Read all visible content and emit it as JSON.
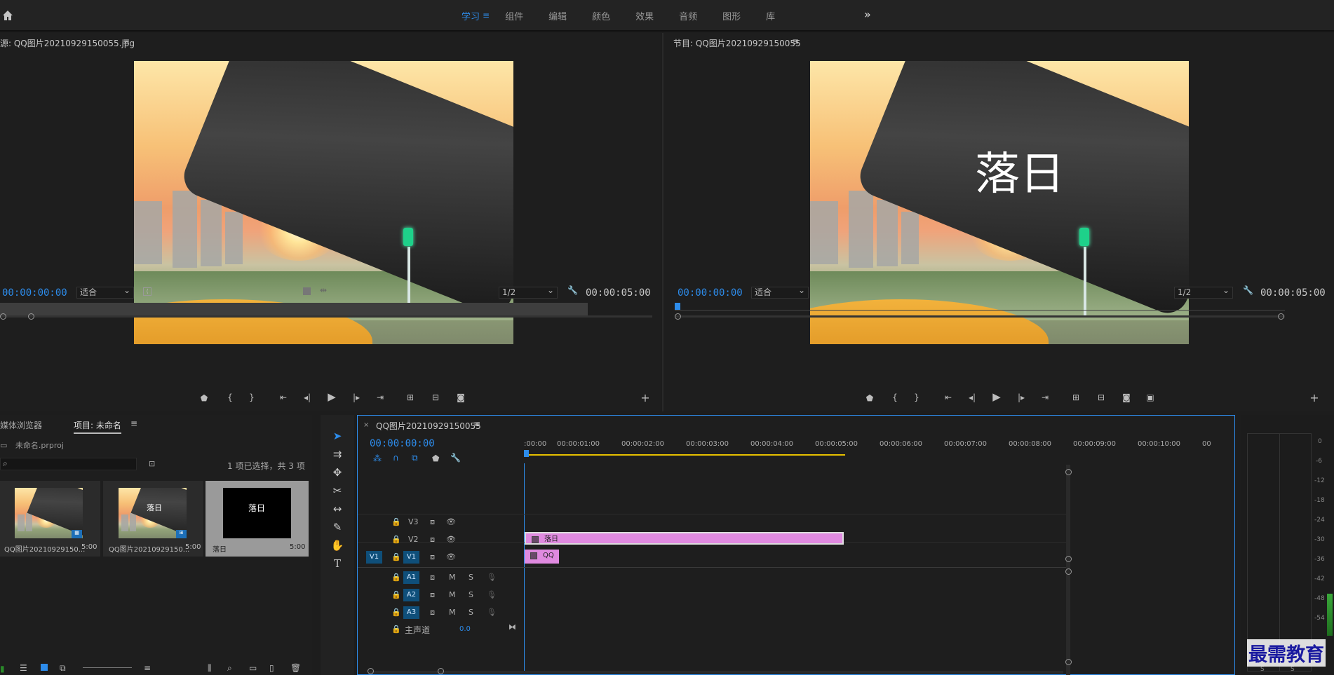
{
  "topbar": {
    "workspaces": [
      "学习",
      "组件",
      "编辑",
      "颜色",
      "效果",
      "音频",
      "图形",
      "库"
    ],
    "active": "学习"
  },
  "source": {
    "title": "源: QQ图片20210929150055.jpg",
    "timecode": "00:00:00:00",
    "fit": "适合",
    "res": "1/2",
    "duration": "00:00:05:00"
  },
  "program": {
    "title": "节目: QQ图片20210929150055",
    "timecode": "00:00:00:00",
    "fit": "适合",
    "res": "1/2",
    "duration": "00:00:05:00",
    "overlay_text": "落日"
  },
  "project": {
    "tab_media": "媒体浏览器",
    "tab_project": "项目: 未命名",
    "file": "未命名.prproj",
    "selection": "1 项已选择，共 3 项",
    "items": [
      {
        "name": "QQ图片20210929150...",
        "dur": "5:00"
      },
      {
        "name": "QQ图片20210929150...",
        "dur": "5:00"
      },
      {
        "name": "落日",
        "dur": "5:00",
        "text": "落日"
      }
    ]
  },
  "timeline": {
    "title": "QQ图片20210929150055",
    "timecode": "00:00:00:00",
    "ruler": [
      ":00:00",
      "00:00:01:00",
      "00:00:02:00",
      "00:00:03:00",
      "00:00:04:00",
      "00:00:05:00",
      "00:00:06:00",
      "00:00:07:00",
      "00:00:08:00",
      "00:00:09:00",
      "00:00:10:00",
      "00"
    ],
    "tracks": {
      "v3": "V3",
      "v2": "V2",
      "v1": "V1",
      "v1_src": "V1",
      "a1": "A1",
      "a2": "A2",
      "a3": "A3"
    },
    "m": "M",
    "s": "S",
    "master": "主声道",
    "master_vol": "0.0",
    "clip_v2": "落日",
    "clip_v1": "QQ"
  },
  "meter": {
    "labels": [
      "0",
      "-6",
      "-12",
      "-18",
      "-24",
      "-30",
      "-36",
      "-42",
      "-48",
      "-54"
    ],
    "s": "S"
  },
  "watermark": "最需教育",
  "colors": {
    "accent": "#2d8ceb",
    "clip": "#e08ae0",
    "track_badge": "#0f4f7a"
  }
}
